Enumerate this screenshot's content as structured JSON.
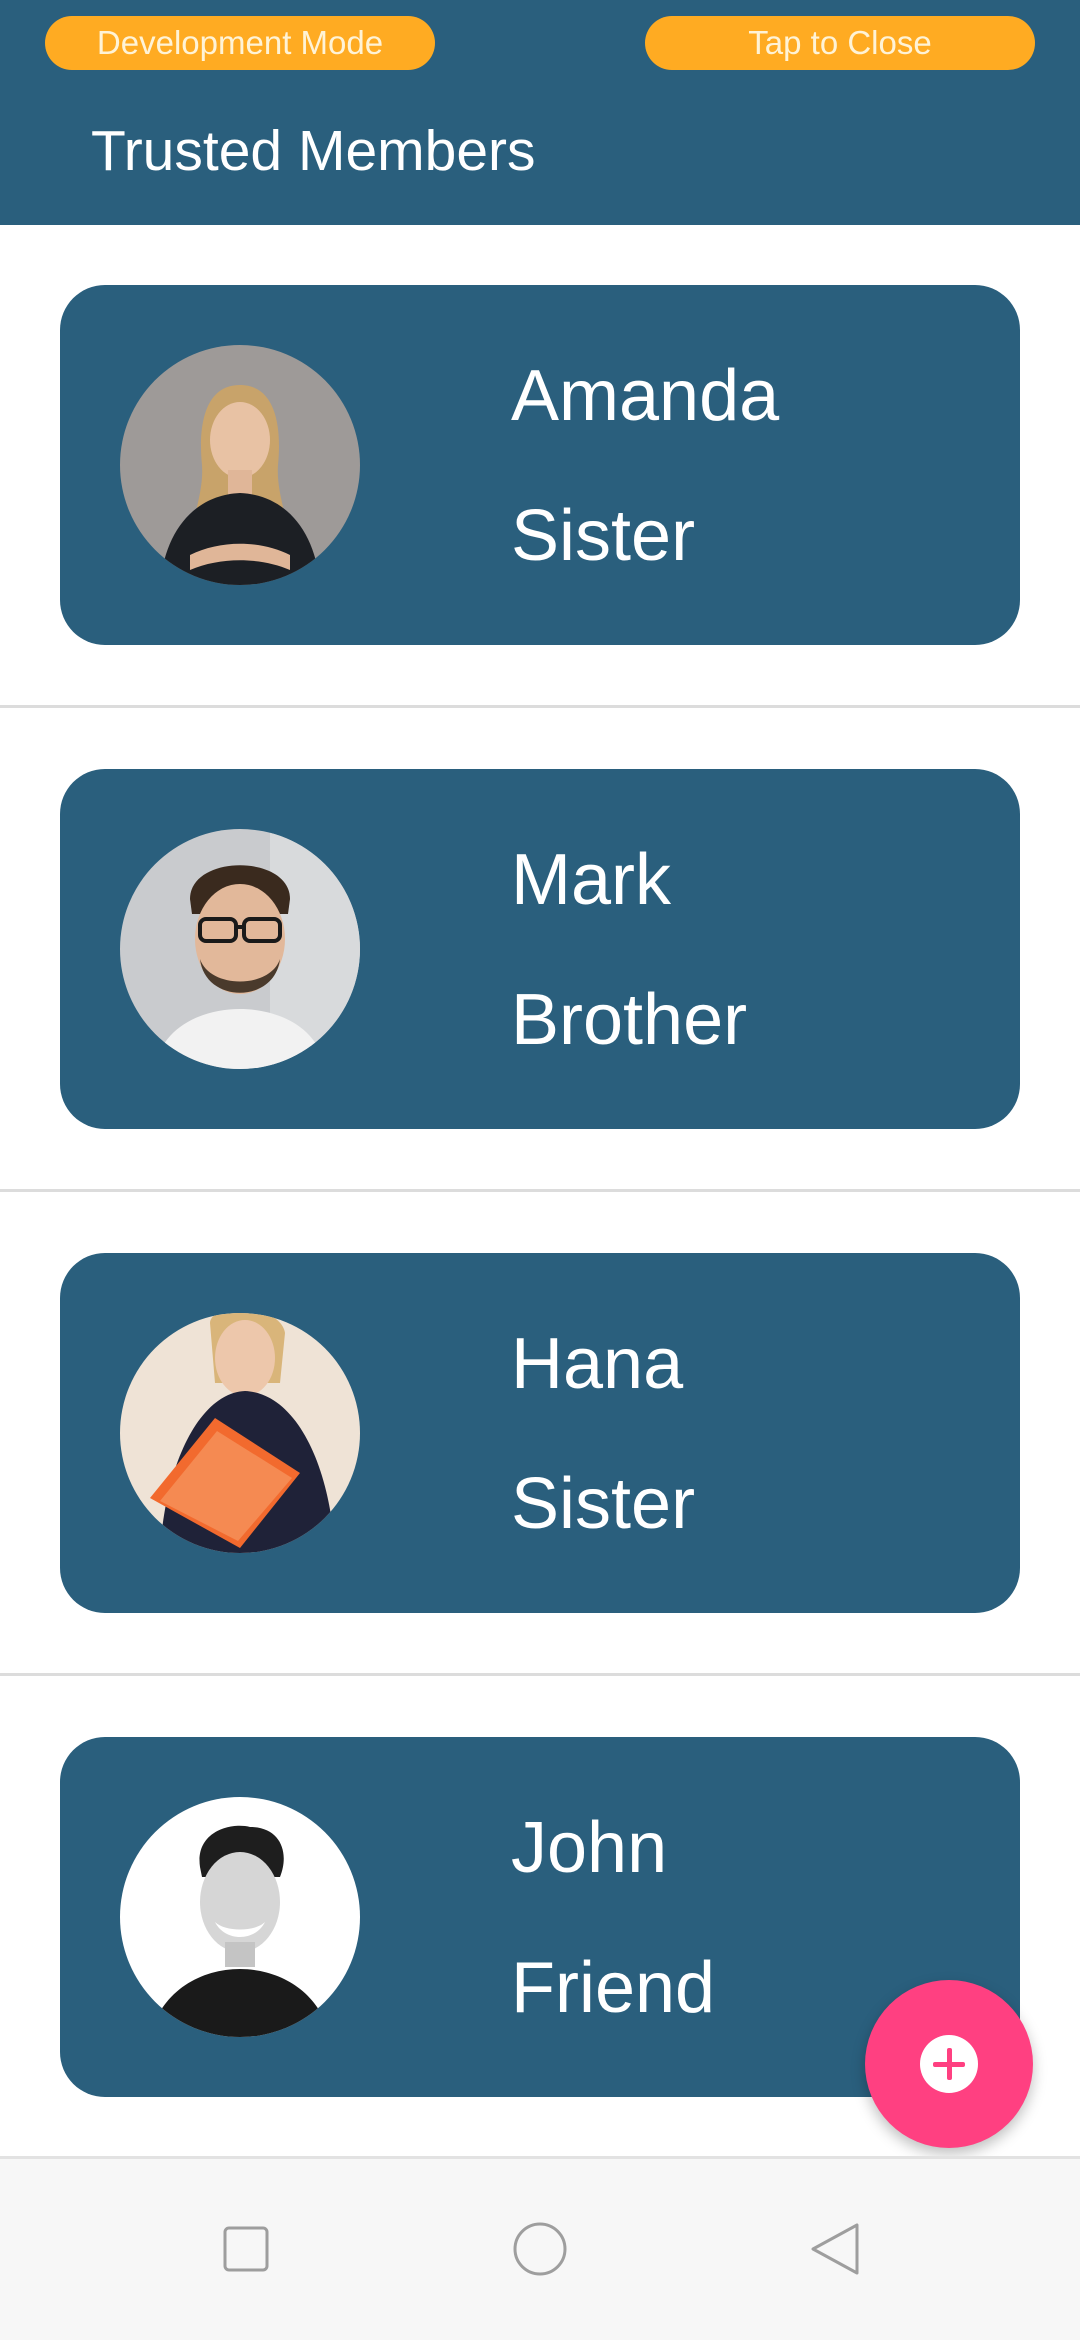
{
  "header": {
    "dev_mode_label": "Development Mode",
    "close_label": "Tap to Close",
    "title": "Trusted Members",
    "background_color": "#2A5F7D",
    "pill_color": "#FFAB22"
  },
  "members": [
    {
      "name": "Amanda",
      "relation": "Sister",
      "avatar": "photo-woman-blonde"
    },
    {
      "name": "Mark",
      "relation": "Brother",
      "avatar": "photo-man-glasses"
    },
    {
      "name": "Hana",
      "relation": "Sister",
      "avatar": "photo-woman-folder"
    },
    {
      "name": "John",
      "relation": "Friend",
      "avatar": "photo-man-bw"
    }
  ],
  "fab": {
    "icon": "add-icon",
    "color": "#FF4081"
  },
  "nav": {
    "items": [
      {
        "icon": "recent-apps-icon"
      },
      {
        "icon": "home-icon"
      },
      {
        "icon": "back-icon"
      }
    ]
  }
}
